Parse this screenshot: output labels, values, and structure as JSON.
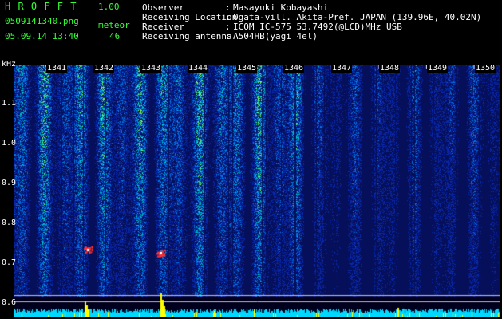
{
  "header": {
    "app_name": "H R O F F T",
    "app_version": "1.00",
    "file_name": "0509141340.png",
    "datetime": "05.09.14 13:40",
    "meteor_label": "meteor",
    "meteor_count": "46"
  },
  "info": [
    {
      "key": "Observer",
      "sep": ":",
      "value": "Masayuki Kobayashi"
    },
    {
      "key": "Receiving Location",
      "sep": ":",
      "value": "Ogata-vill. Akita-Pref. JAPAN (139.96E, 40.02N)"
    },
    {
      "key": "Receiver",
      "sep": ":",
      "value": "ICOM IC-575 53.7492(@LCD)MHz USB"
    },
    {
      "key": "Receiving antenna",
      "sep": ":",
      "value": "A504HB(yagi 4el)"
    }
  ],
  "y_axis": {
    "unit": "kHz",
    "ticks": [
      "1.1",
      "1.0",
      "0.9",
      "0.8",
      "0.7",
      "0.6"
    ]
  },
  "x_axis": {
    "ticks": [
      "1341",
      "1342",
      "1343",
      "1344",
      "1345",
      "1346",
      "1347",
      "1348",
      "1349",
      "1350"
    ]
  },
  "colors": {
    "background": "#000000",
    "header_green": "#33ff33",
    "plot_deep": "#0a1a7a",
    "signal_cyan": "#00d8ff",
    "signal_yellow": "#ffff00",
    "signal_red": "#ff3030"
  }
}
